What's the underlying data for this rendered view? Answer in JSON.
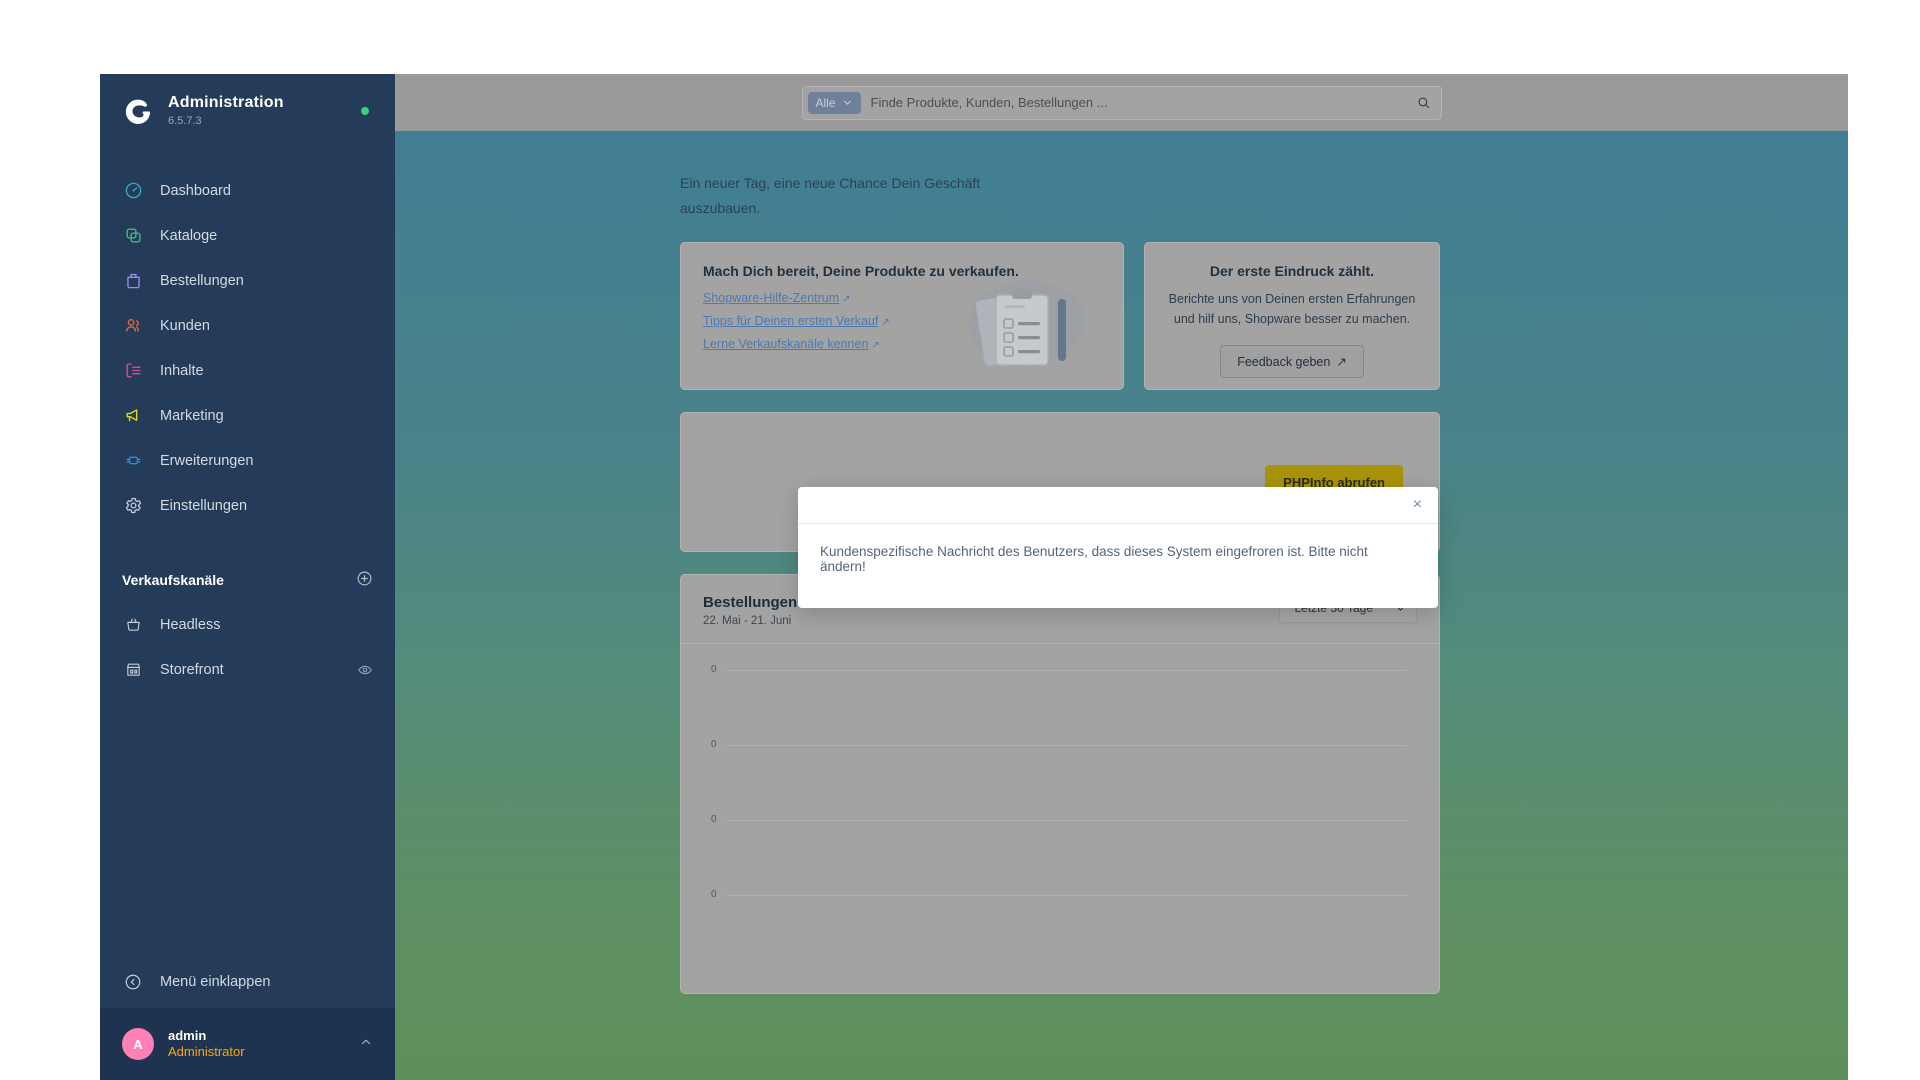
{
  "sidebar": {
    "brand": {
      "title": "Administration",
      "version": "6.5.7.3",
      "status_color": "#37d279"
    },
    "items": [
      {
        "label": "Dashboard",
        "icon": "dashboard-icon",
        "color": "#3aa9c4"
      },
      {
        "label": "Kataloge",
        "icon": "catalogs-icon",
        "color": "#3ec27d"
      },
      {
        "label": "Bestellungen",
        "icon": "orders-icon",
        "color": "#9b8cf0"
      },
      {
        "label": "Kunden",
        "icon": "customers-icon",
        "color": "#e06b3e"
      },
      {
        "label": "Inhalte",
        "icon": "content-icon",
        "color": "#e0479b"
      },
      {
        "label": "Marketing",
        "icon": "marketing-icon",
        "color": "#e8d91f"
      },
      {
        "label": "Erweiterungen",
        "icon": "extensions-icon",
        "color": "#1f8ef1"
      },
      {
        "label": "Einstellungen",
        "icon": "settings-gear-icon",
        "color": "#c3ccd6"
      }
    ],
    "sales_channels": {
      "title": "Verkaufskanäle",
      "add_label": "+",
      "items": [
        {
          "label": "Headless",
          "icon": "basket-icon",
          "trailing": ""
        },
        {
          "label": "Storefront",
          "icon": "storefront-icon",
          "trailing": "eye-icon"
        }
      ]
    },
    "collapse_label": "Menü einklappen",
    "user": {
      "initial": "A",
      "name": "admin",
      "role": "Administrator",
      "role_color": "#ffa800"
    }
  },
  "topbar": {
    "search": {
      "scope_label": "Alle",
      "placeholder": "Finde Produkte, Kunden, Bestellungen ...",
      "value": ""
    }
  },
  "main": {
    "greeting": "Ein neuer Tag, eine neue Chance Dein Geschäft auszubauen.",
    "card_sell": {
      "title": "Mach Dich bereit, Deine Produkte zu verkaufen.",
      "links": [
        "Shopware-Hilfe-Zentrum",
        "Tipps für Deinen ersten Verkauf",
        "Lerne Verkaufskanäle kennen"
      ]
    },
    "card_feedback": {
      "title": "Der erste Eindruck zählt.",
      "text": "Berichte uns von Deinen ersten Erfahrungen und hilf uns, Shopware besser zu machen.",
      "button": "Feedback geben"
    },
    "card_phpinfo": {
      "button": "PHPInfo abrufen",
      "button_color": "#a8930a"
    }
  },
  "chart_data": {
    "type": "line",
    "title": "Bestellungen",
    "subtitle": "22. Mai - 21. Juni",
    "range_select": "Letzte 30 Tage",
    "xlabel": "",
    "ylabel": "",
    "grid": true,
    "legend": "none",
    "ytick_labels": [
      "0",
      "0",
      "0",
      "0"
    ],
    "categories": [],
    "values": [],
    "ylim": [
      0,
      0
    ]
  },
  "modal": {
    "close_label": "×",
    "message": "Kundenspezifische Nachricht des Benutzers, dass dieses System eingefroren ist. Bitte nicht ändern!"
  }
}
